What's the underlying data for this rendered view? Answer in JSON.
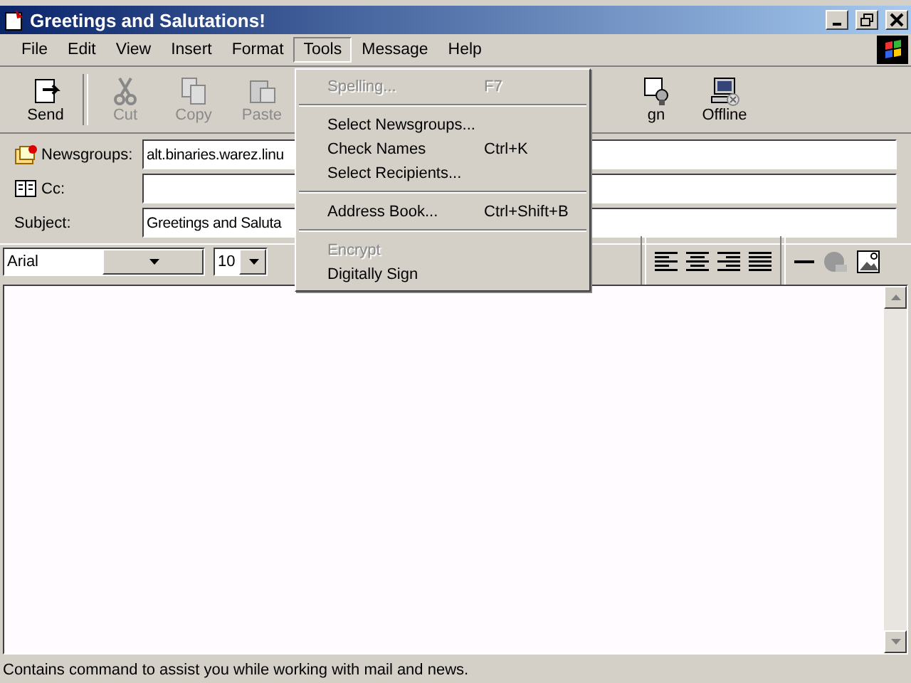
{
  "window": {
    "title": "Greetings and Salutations!"
  },
  "menu_bar": [
    {
      "label": "File",
      "selected": false
    },
    {
      "label": "Edit",
      "selected": false
    },
    {
      "label": "View",
      "selected": false
    },
    {
      "label": "Insert",
      "selected": false
    },
    {
      "label": "Format",
      "selected": false
    },
    {
      "label": "Tools",
      "selected": true
    },
    {
      "label": "Message",
      "selected": false
    },
    {
      "label": "Help",
      "selected": false
    }
  ],
  "toolbar": [
    {
      "label": "Send",
      "disabled": false
    },
    {
      "label": "Cut",
      "disabled": true
    },
    {
      "label": "Copy",
      "disabled": true
    },
    {
      "label": "Paste",
      "disabled": true
    },
    {
      "label": "gn",
      "disabled": false
    },
    {
      "label": "Offline",
      "disabled": false
    }
  ],
  "header_fields": [
    {
      "label": "Newsgroups:",
      "value": "alt.binaries.warez.linu"
    },
    {
      "label": "Cc:"
    },
    {
      "label": "Subject:",
      "value": "Greetings and Saluta"
    }
  ],
  "format_bar": {
    "font": "Arial",
    "size": "10"
  },
  "tools_menu": [
    {
      "kind": "item",
      "label": "Spelling...",
      "shortcut": "F7",
      "disabled": true
    },
    {
      "kind": "separator"
    },
    {
      "kind": "item",
      "label": "Select Newsgroups...",
      "disabled": false
    },
    {
      "kind": "item",
      "label": "Check Names",
      "shortcut": "Ctrl+K",
      "disabled": false
    },
    {
      "kind": "item",
      "label": "Select Recipients...",
      "disabled": false
    },
    {
      "kind": "separator"
    },
    {
      "kind": "item",
      "label": "Address Book...",
      "shortcut": "Ctrl+Shift+B",
      "disabled": false
    },
    {
      "kind": "separator"
    },
    {
      "kind": "item",
      "label": "Encrypt",
      "disabled": true
    },
    {
      "kind": "item",
      "label": "Digitally Sign",
      "disabled": false
    }
  ],
  "status_bar": "Contains command to assist you while working with mail and news."
}
